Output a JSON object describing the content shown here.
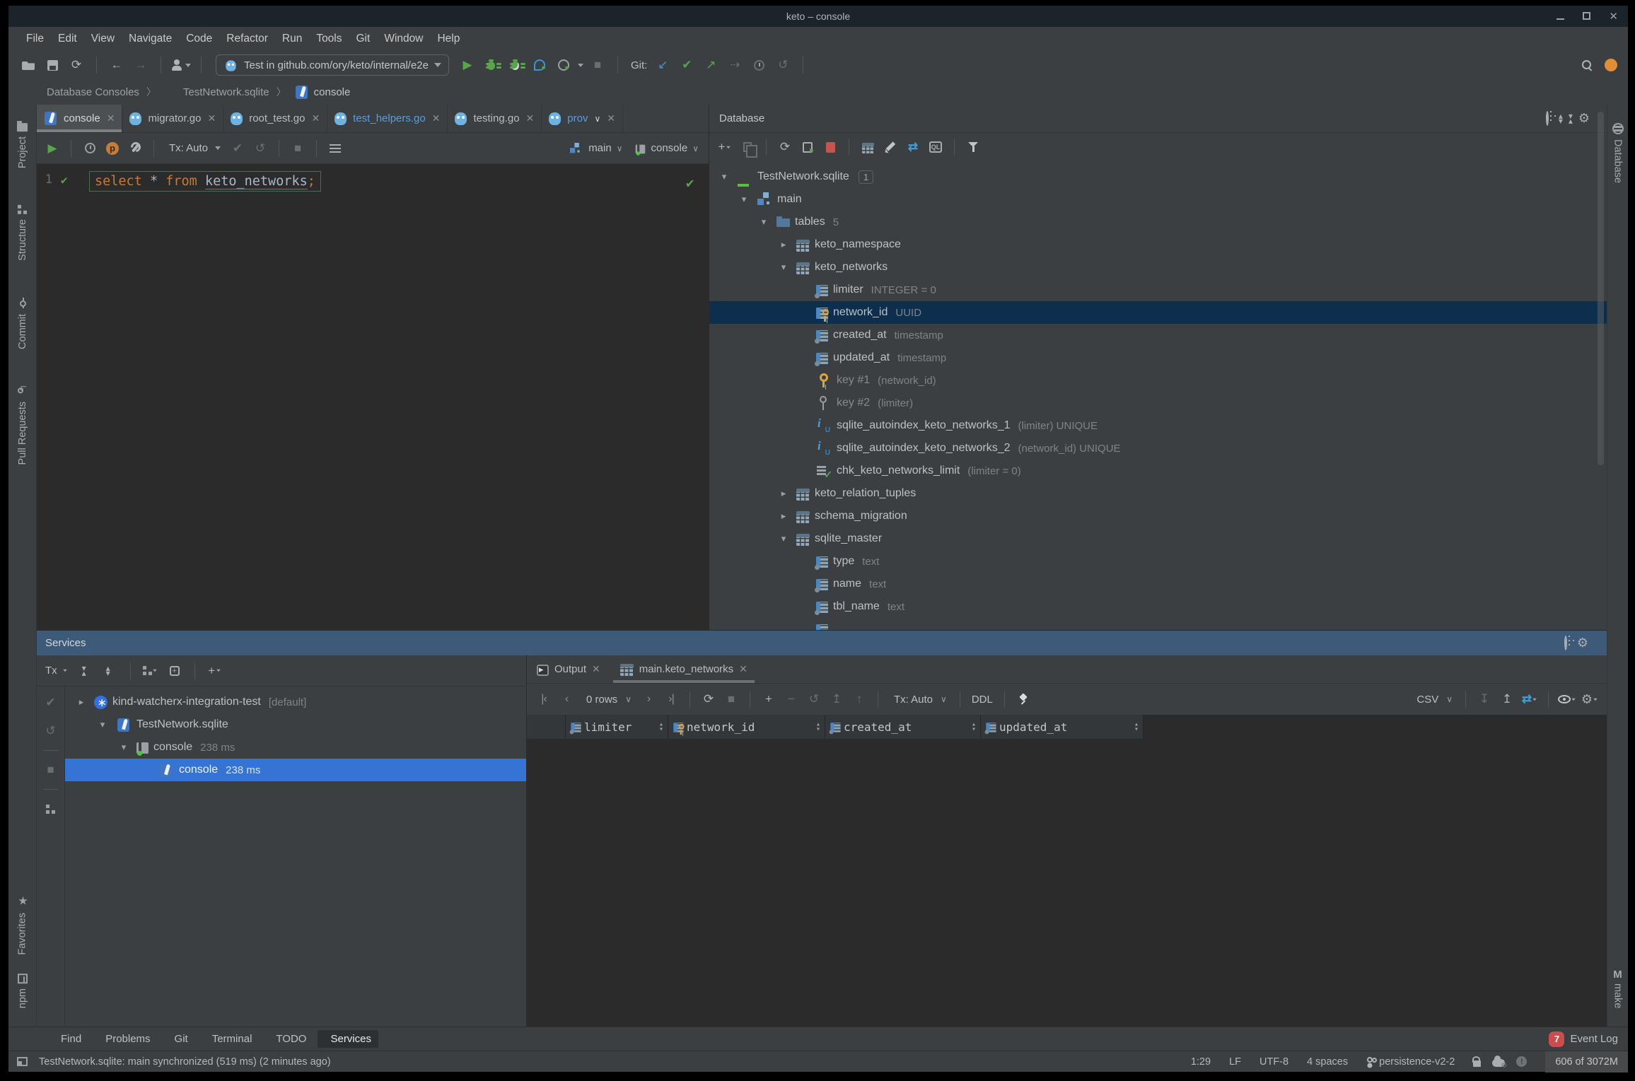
{
  "window": {
    "title": "keto – console"
  },
  "menu": {
    "items": [
      {
        "label": "File"
      },
      {
        "label": "Edit"
      },
      {
        "label": "View"
      },
      {
        "label": "Navigate"
      },
      {
        "label": "Code"
      },
      {
        "label": "Refactor"
      },
      {
        "label": "Run"
      },
      {
        "label": "Tools"
      },
      {
        "label": "Git"
      },
      {
        "label": "Window"
      },
      {
        "label": "Help"
      }
    ]
  },
  "toolbar": {
    "run_config": "Test in github.com/ory/keto/internal/e2e",
    "git_label": "Git:"
  },
  "breadcrumbs": {
    "items": [
      {
        "label": "Database Consoles"
      },
      {
        "label": "TestNetwork.sqlite"
      },
      {
        "label": "console",
        "icon": "console-file"
      }
    ]
  },
  "left_stripe": {
    "top": [
      {
        "label": "Project"
      },
      {
        "label": "Structure"
      },
      {
        "label": "Commit"
      },
      {
        "label": "Pull Requests"
      }
    ],
    "bottom": [
      {
        "label": "Favorites"
      },
      {
        "label": "npm"
      }
    ]
  },
  "right_stripe": {
    "top_label": "Database",
    "bottom_label": "make",
    "bottom_mnemonic": "M"
  },
  "editor_tabs": {
    "tabs": [
      {
        "label": "console",
        "icon": "console-file",
        "selected": true
      },
      {
        "label": "migrator.go",
        "icon": "go-file"
      },
      {
        "label": "root_test.go",
        "icon": "go-file"
      },
      {
        "label": "test_helpers.go",
        "icon": "go-file",
        "modified": true
      },
      {
        "label": "testing.go",
        "icon": "go-file"
      },
      {
        "label": "prov",
        "icon": "go-file",
        "modified": true,
        "has_dropdown": true
      }
    ]
  },
  "console_toolbar": {
    "tx_label": "Tx: Auto",
    "schema_label": "main",
    "session_label": "console"
  },
  "editor": {
    "line_number": "1",
    "code": {
      "kw1": "select",
      "star": " * ",
      "kw2": "from",
      "ident": "keto_networks",
      "semi": ";"
    }
  },
  "database": {
    "title": "Database",
    "tree": [
      {
        "lvl": 0,
        "expanded": true,
        "icon": "sqlite-active",
        "label": "TestNetwork.sqlite",
        "badge": "1"
      },
      {
        "lvl": 1,
        "expanded": true,
        "icon": "schema",
        "label": "main"
      },
      {
        "lvl": 2,
        "expanded": true,
        "icon": "folder",
        "label": "tables",
        "meta": "5"
      },
      {
        "lvl": 3,
        "collapsed": true,
        "icon": "table",
        "label": "keto_namespace"
      },
      {
        "lvl": 3,
        "expanded": true,
        "icon": "table",
        "label": "keto_networks"
      },
      {
        "lvl": 4,
        "icon": "column",
        "label": "limiter",
        "meta": "INTEGER = 0"
      },
      {
        "lvl": 4,
        "icon": "column-key",
        "label": "network_id",
        "meta": "UUID",
        "selected": true
      },
      {
        "lvl": 4,
        "icon": "column",
        "label": "created_at",
        "meta": "timestamp"
      },
      {
        "lvl": 4,
        "icon": "column",
        "label": "updated_at",
        "meta": "timestamp"
      },
      {
        "lvl": 4,
        "icon": "key-gold",
        "label": "key #1",
        "meta": "(network_id)",
        "dim": true
      },
      {
        "lvl": 4,
        "icon": "key-gray",
        "label": "key #2",
        "meta": "(limiter)",
        "dim": true
      },
      {
        "lvl": 4,
        "icon": "index",
        "label": "sqlite_autoindex_keto_networks_1",
        "meta": "(limiter) UNIQUE"
      },
      {
        "lvl": 4,
        "icon": "index",
        "label": "sqlite_autoindex_keto_networks_2",
        "meta": "(network_id) UNIQUE"
      },
      {
        "lvl": 4,
        "icon": "constraint",
        "label": "chk_keto_networks_limit",
        "meta": "(limiter = 0)"
      },
      {
        "lvl": 3,
        "collapsed": true,
        "icon": "table",
        "label": "keto_relation_tuples"
      },
      {
        "lvl": 3,
        "collapsed": true,
        "icon": "table",
        "label": "schema_migration"
      },
      {
        "lvl": 3,
        "expanded": true,
        "icon": "table",
        "label": "sqlite_master"
      },
      {
        "lvl": 4,
        "icon": "column",
        "label": "type",
        "meta": "text"
      },
      {
        "lvl": 4,
        "icon": "column",
        "label": "name",
        "meta": "text"
      },
      {
        "lvl": 4,
        "icon": "column",
        "label": "tbl_name",
        "meta": "text"
      },
      {
        "lvl": 4,
        "icon": "column",
        "label": ""
      }
    ]
  },
  "services": {
    "title": "Services",
    "tx_label": "Tx",
    "tree": [
      {
        "lvl": 0,
        "collapsed": true,
        "icon": "k8s",
        "label": "kind-watcherx-integration-test",
        "meta": "[default]"
      },
      {
        "lvl": 1,
        "expanded": true,
        "icon": "sqlite",
        "label": "TestNetwork.sqlite"
      },
      {
        "lvl": 2,
        "expanded": true,
        "icon": "console-session",
        "label": "console",
        "meta": "238 ms"
      },
      {
        "lvl": 3,
        "icon": "sqlite",
        "label": "console",
        "meta": "238 ms",
        "selected": true
      }
    ]
  },
  "output": {
    "tabs": [
      {
        "label": "Output",
        "icon": "output"
      },
      {
        "label": "main.keto_networks",
        "icon": "table",
        "selected": true
      }
    ],
    "rows_label": "0 rows",
    "tx_label": "Tx: Auto",
    "ddl_label": "DDL",
    "csv_label": "CSV",
    "columns": [
      {
        "label": "limiter",
        "icon": "column"
      },
      {
        "label": "network_id",
        "icon": "column-key"
      },
      {
        "label": "created_at",
        "icon": "column"
      },
      {
        "label": "updated_at",
        "icon": "column"
      }
    ]
  },
  "bottom_bar": {
    "items": [
      {
        "label": "Find",
        "icon": "search"
      },
      {
        "label": "Problems",
        "icon": "error"
      },
      {
        "label": "Git",
        "icon": "branch"
      },
      {
        "label": "Terminal",
        "icon": "terminal"
      },
      {
        "label": "TODO",
        "icon": "todo"
      },
      {
        "label": "Services",
        "icon": "services",
        "active": true
      }
    ],
    "event_log": {
      "badge": "7",
      "label": "Event Log"
    }
  },
  "status_bar": {
    "message": "TestNetwork.sqlite: main synchronized (519 ms) (2 minutes ago)",
    "segments": [
      {
        "label": "1:29"
      },
      {
        "label": "LF"
      },
      {
        "label": "UTF-8"
      },
      {
        "label": "4 spaces"
      }
    ],
    "branch": "persistence-v2-2",
    "memory": "606 of 3072M"
  },
  "colors": {
    "selection_focused": "#3674d3",
    "selection_unfocused": "#0d2e4c",
    "tool_header_active": "#3d5a78",
    "keyword_orange": "#cc7832",
    "success_green": "#57a64a",
    "error_red": "#c75450",
    "key_gold": "#d9a444",
    "index_blue": "#4b9fde",
    "modified_file_blue": "#559fe0",
    "event_badge_red": "#cc4d4d"
  }
}
